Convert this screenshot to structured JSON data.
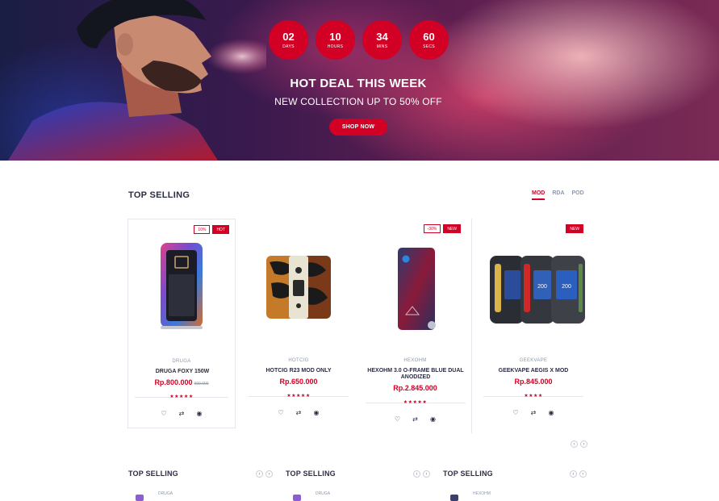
{
  "hero": {
    "timer": [
      {
        "value": "02",
        "label": "DAYS"
      },
      {
        "value": "10",
        "label": "HOURS"
      },
      {
        "value": "34",
        "label": "MINS"
      },
      {
        "value": "60",
        "label": "SECS"
      }
    ],
    "title": "HOT DEAL THIS WEEK",
    "subtitle": "NEW COLLECTION UP TO 50% OFF",
    "button": "SHOP NOW"
  },
  "section": {
    "title": "TOP SELLING",
    "tabs": [
      "MOD",
      "RDA",
      "POD"
    ],
    "active_tab": "MOD"
  },
  "products": [
    {
      "brand": "DRUGA",
      "name": "DRUGA FOXY 150W",
      "price": "Rp.800.000",
      "old_price": "900.000",
      "sale": "10%",
      "tag": "HOT",
      "stars": "★★★★★"
    },
    {
      "brand": "HOTCIG",
      "name": "HOTCIG R23 MOD ONLY",
      "price": "Rp.650.000",
      "old_price": "",
      "sale": "",
      "tag": "",
      "stars": "★★★★★"
    },
    {
      "brand": "HEXOHM",
      "name": "HEXOHM 3.0 O-FRAME BLUE DUAL ANODIZED",
      "price": "Rp.2.845.000",
      "old_price": "",
      "sale": "-30%",
      "tag": "NEW",
      "stars": "★★★★★"
    },
    {
      "brand": "GEEKVAPE",
      "name": "GEEKVAPE AEGIS X MOD",
      "price": "Rp.845.000",
      "old_price": "",
      "sale": "",
      "tag": "NEW",
      "stars": "★★★★"
    }
  ],
  "widgets": [
    {
      "title": "TOP SELLING",
      "first_brand": "DRUGA"
    },
    {
      "title": "TOP SELLING",
      "first_brand": "DRUGA"
    },
    {
      "title": "TOP SELLING",
      "first_brand": "HEXOHM"
    }
  ],
  "arrows": {
    "prev": "‹",
    "next": "›"
  },
  "icons": {
    "wishlist": "heart-icon",
    "compare": "exchange-icon",
    "quickview": "eye-icon"
  },
  "colors": {
    "accent": "#d10024",
    "text": "#2b2d42",
    "muted": "#8d99ae",
    "border": "#e4e7ed"
  }
}
